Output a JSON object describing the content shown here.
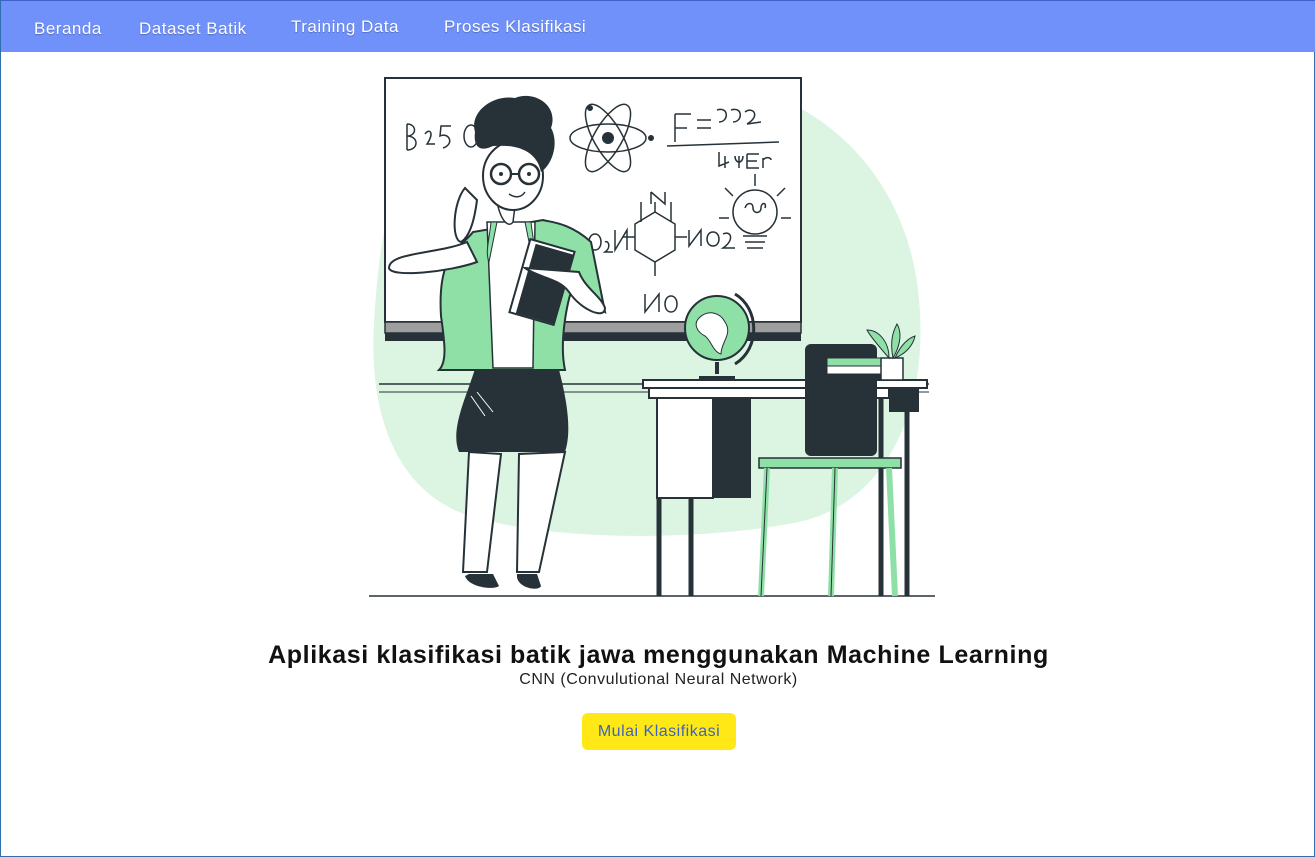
{
  "navbar": {
    "items": [
      {
        "label": "Beranda"
      },
      {
        "label": "Dataset Batik"
      },
      {
        "label": "Training Data"
      },
      {
        "label": "Proses Klasifikasi"
      }
    ]
  },
  "hero": {
    "illustration": "teacher-at-whiteboard-illustration",
    "title": "Aplikasi klasifikasi batik jawa menggunakan Machine Learning",
    "subtitle": "CNN (Convulutional Neural Network)",
    "cta_label": "Mulai Klasifikasi"
  },
  "colors": {
    "navbar": "#7091f9",
    "cta_background": "#ffe816",
    "cta_text": "#3b63c4",
    "illustration_accent": "#8fe0a6"
  }
}
